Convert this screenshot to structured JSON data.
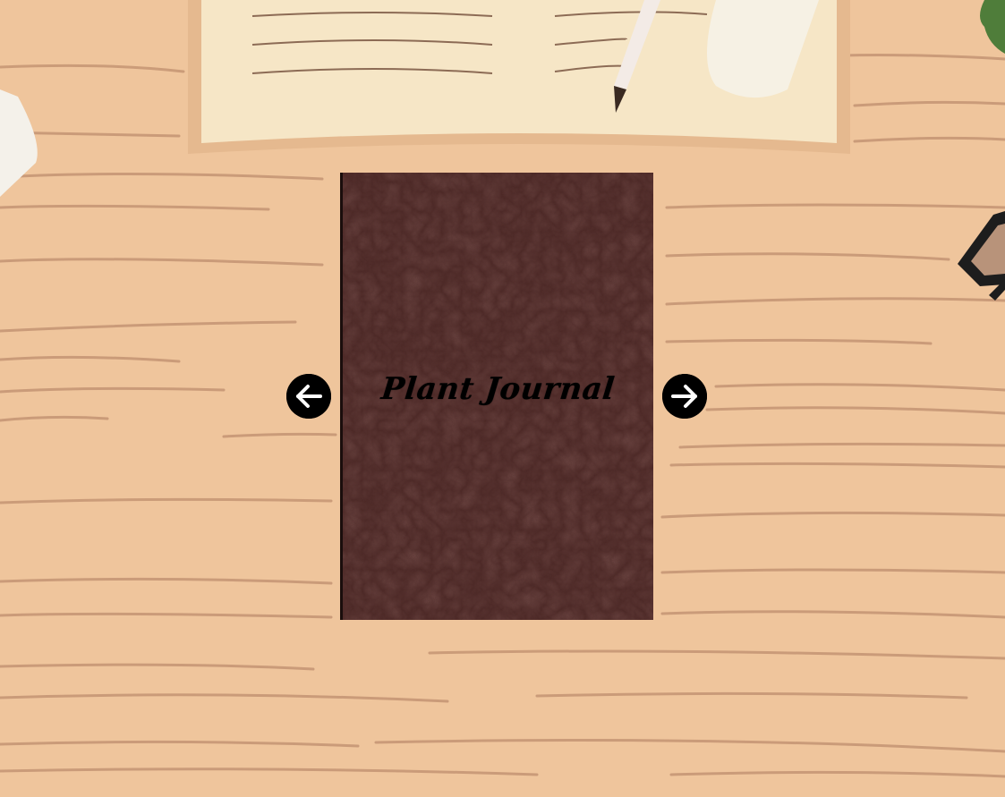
{
  "journal": {
    "title": "Plant Journal"
  },
  "navigation": {
    "previous_icon": "arrow-left-icon",
    "next_icon": "arrow-right-icon"
  },
  "colors": {
    "desk": "#efc59c",
    "cover": "#4a2522",
    "buttons": "#000000"
  }
}
